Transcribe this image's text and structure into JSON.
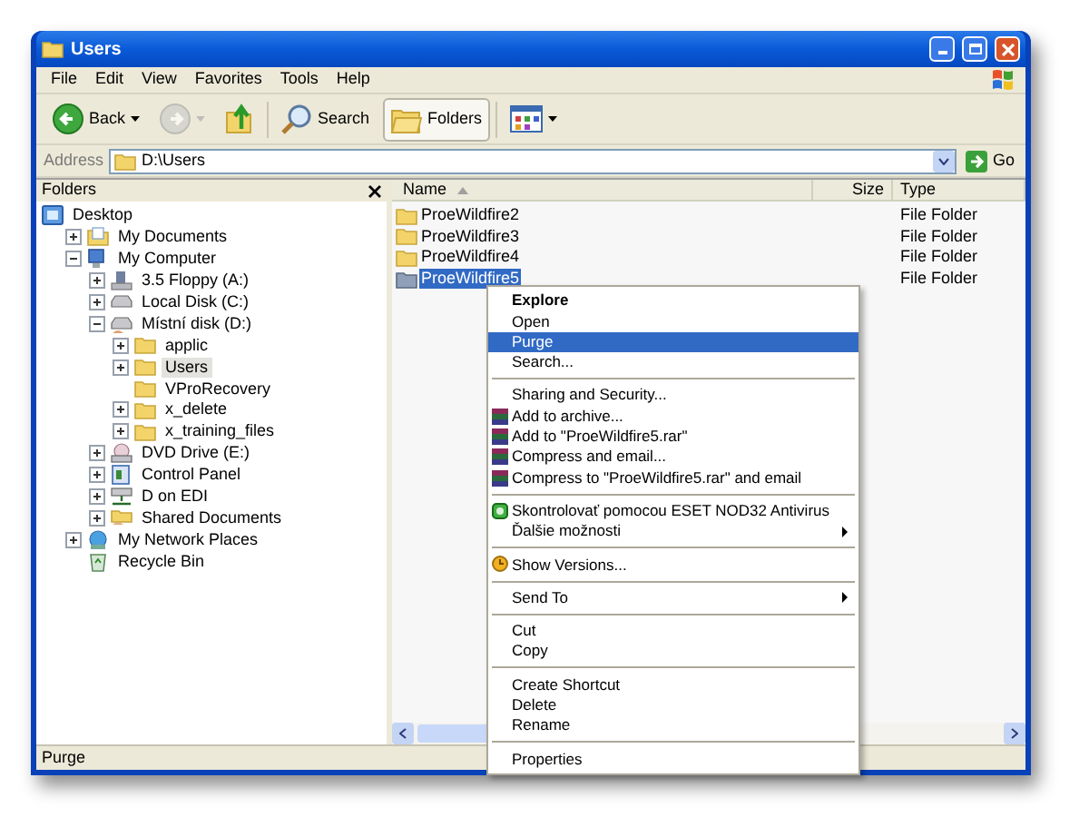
{
  "window": {
    "title": "Users"
  },
  "menu_bar": [
    "File",
    "Edit",
    "View",
    "Favorites",
    "Tools",
    "Help"
  ],
  "toolbar": [
    {
      "kind": "back",
      "label": "Back",
      "disabled": false,
      "selected": false
    },
    {
      "kind": "forward",
      "disabled": true,
      "selected": false
    },
    {
      "kind": "up",
      "disabled": false,
      "selected": false
    },
    {
      "kind": "search",
      "label": "Search",
      "disabled": false,
      "selected": false
    },
    {
      "kind": "folders",
      "label": "Folders",
      "disabled": false,
      "selected": true
    },
    {
      "kind": "views",
      "disabled": false,
      "selected": false
    }
  ],
  "address": {
    "label": "Address",
    "value": "D:\\Users",
    "go": "Go"
  },
  "folders_pane": {
    "title": "Folders",
    "tree": [
      {
        "label": "Desktop",
        "kind": "desktop",
        "expandable": false,
        "selected": false,
        "children": [
          {
            "label": "My Documents",
            "kind": "documents",
            "expandable": true,
            "selected": false
          },
          {
            "label": "My Computer",
            "kind": "computer",
            "expandable": true,
            "selected": false,
            "children": [
              {
                "label": "3.5 Floppy (A:)",
                "kind": "floppy",
                "expandable": true,
                "selected": false
              },
              {
                "label": "Local Disk (C:)",
                "kind": "disk",
                "expandable": true,
                "selected": false
              },
              {
                "label": "Místní disk (D:)",
                "kind": "shared-disk",
                "expandable": true,
                "selected": false,
                "children": [
                  {
                    "label": "applic",
                    "kind": "folder",
                    "expandable": true,
                    "selected": false
                  },
                  {
                    "label": "Users",
                    "kind": "folder",
                    "expandable": true,
                    "selected": true
                  },
                  {
                    "label": "VProRecovery",
                    "kind": "folder",
                    "expandable": false,
                    "selected": false
                  },
                  {
                    "label": "x_delete",
                    "kind": "folder",
                    "expandable": true,
                    "selected": false
                  },
                  {
                    "label": "x_training_files",
                    "kind": "folder",
                    "expandable": true,
                    "selected": false
                  }
                ]
              },
              {
                "label": "DVD Drive (E:)",
                "kind": "dvd",
                "expandable": true,
                "selected": false
              },
              {
                "label": "Control Panel",
                "kind": "control-panel",
                "expandable": true,
                "selected": false
              },
              {
                "label": "D on EDI",
                "kind": "network-drive",
                "expandable": true,
                "selected": false
              },
              {
                "label": "Shared Documents",
                "kind": "shared-folder",
                "expandable": true,
                "selected": false
              }
            ]
          },
          {
            "label": "My Network Places",
            "kind": "network",
            "expandable": true,
            "selected": false
          },
          {
            "label": "Recycle Bin",
            "kind": "recycle",
            "expandable": false,
            "selected": false
          }
        ]
      }
    ]
  },
  "file_list": {
    "columns": [
      {
        "label": "Name",
        "sorted": true
      },
      {
        "label": "Size",
        "sorted": false
      },
      {
        "label": "Type",
        "sorted": false
      }
    ],
    "rows": [
      {
        "name": "ProeWildfire2",
        "type": "File Folder",
        "selected": false
      },
      {
        "name": "ProeWildfire3",
        "type": "File Folder",
        "selected": false
      },
      {
        "name": "ProeWildfire4",
        "type": "File Folder",
        "selected": false
      },
      {
        "name": "ProeWildfire5",
        "type": "File Folder",
        "selected": true
      }
    ]
  },
  "context_menu": {
    "items": [
      {
        "kind": "plain",
        "label": "Explore",
        "default": true,
        "selected": false,
        "submenu": false
      },
      {
        "kind": "plain",
        "label": "Open",
        "default": false,
        "selected": false,
        "submenu": false
      },
      {
        "kind": "plain",
        "label": "Purge",
        "default": false,
        "selected": true,
        "submenu": false
      },
      {
        "kind": "plain",
        "label": "Search...",
        "default": false,
        "selected": false,
        "submenu": false
      },
      {
        "kind": "separator"
      },
      {
        "kind": "plain",
        "label": "Sharing and Security...",
        "default": false,
        "selected": false,
        "submenu": false
      },
      {
        "kind": "archive",
        "label": "Add to archive...",
        "default": false,
        "selected": false,
        "submenu": false
      },
      {
        "kind": "archive",
        "label": "Add to \"ProeWildfire5.rar\"",
        "default": false,
        "selected": false,
        "submenu": false
      },
      {
        "kind": "archive",
        "label": "Compress and email...",
        "default": false,
        "selected": false,
        "submenu": false
      },
      {
        "kind": "archive",
        "label": "Compress to \"ProeWildfire5.rar\" and email",
        "default": false,
        "selected": false,
        "submenu": false
      },
      {
        "kind": "separator"
      },
      {
        "kind": "antivirus",
        "label": "Skontrolovať pomocou ESET NOD32 Antivirus",
        "default": false,
        "selected": false,
        "submenu": false
      },
      {
        "kind": "plain",
        "label": "Ďalšie možnosti",
        "default": false,
        "selected": false,
        "submenu": true
      },
      {
        "kind": "separator"
      },
      {
        "kind": "versions",
        "label": "Show Versions...",
        "default": false,
        "selected": false,
        "submenu": false
      },
      {
        "kind": "separator"
      },
      {
        "kind": "plain",
        "label": "Send To",
        "default": false,
        "selected": false,
        "submenu": true
      },
      {
        "kind": "separator"
      },
      {
        "kind": "plain",
        "label": "Cut",
        "default": false,
        "selected": false,
        "submenu": false
      },
      {
        "kind": "plain",
        "label": "Copy",
        "default": false,
        "selected": false,
        "submenu": false
      },
      {
        "kind": "separator"
      },
      {
        "kind": "plain",
        "label": "Create Shortcut",
        "default": false,
        "selected": false,
        "submenu": false
      },
      {
        "kind": "plain",
        "label": "Delete",
        "default": false,
        "selected": false,
        "submenu": false
      },
      {
        "kind": "plain",
        "label": "Rename",
        "default": false,
        "selected": false,
        "submenu": false
      },
      {
        "kind": "separator"
      },
      {
        "kind": "plain",
        "label": "Properties",
        "default": false,
        "selected": false,
        "submenu": false
      }
    ]
  },
  "status_bar": "Purge"
}
